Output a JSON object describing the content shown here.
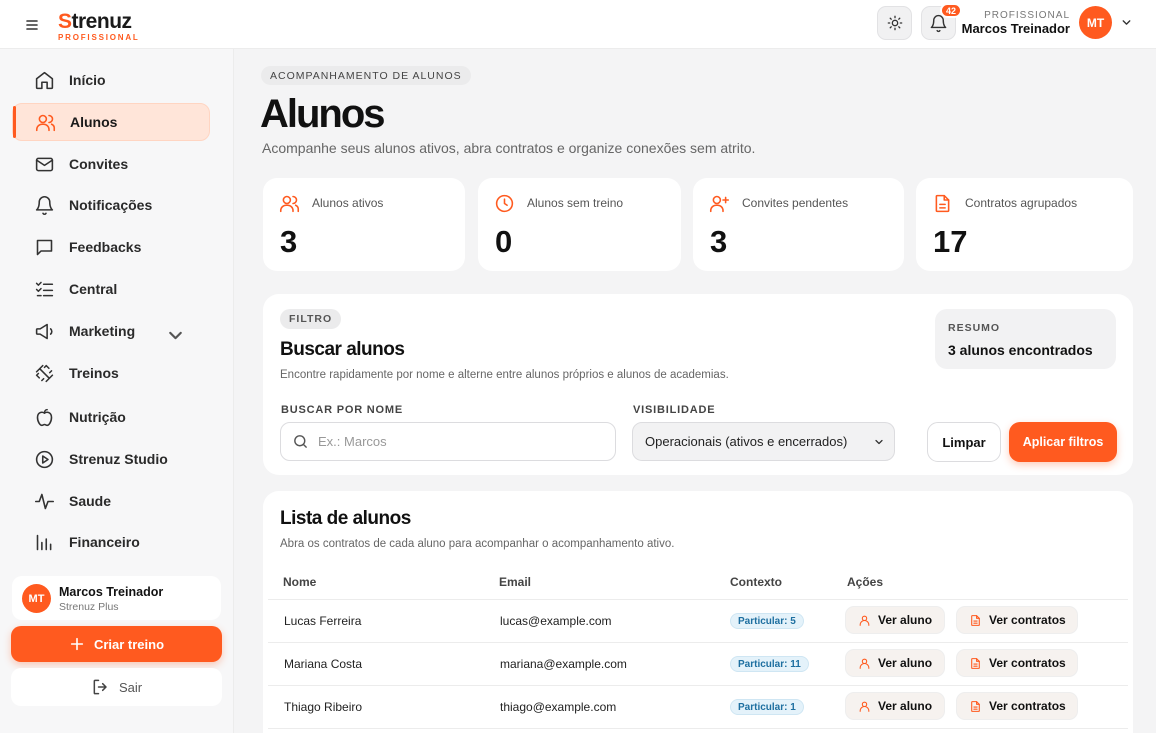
{
  "header": {
    "logo_main": "trenuz",
    "logo_s": "S",
    "logo_sub": "PROFISSIONAL",
    "notifications_count": "42",
    "user_role": "PROFISSIONAL",
    "user_name": "Marcos Treinador",
    "avatar_initials": "MT"
  },
  "sidebar": {
    "items": [
      {
        "label": "Início",
        "icon": "home-icon"
      },
      {
        "label": "Alunos",
        "icon": "users-icon",
        "active": true
      },
      {
        "label": "Convites",
        "icon": "mail-icon"
      },
      {
        "label": "Notificações",
        "icon": "bell-icon"
      },
      {
        "label": "Feedbacks",
        "icon": "chat-icon"
      },
      {
        "label": "Central",
        "icon": "list-check-icon"
      },
      {
        "label": "Marketing",
        "icon": "megaphone-icon",
        "expandable": true
      },
      {
        "label": "Treinos",
        "icon": "dumbbell-icon"
      },
      {
        "label": "Nutrição",
        "icon": "apple-icon"
      },
      {
        "label": "Strenuz Studio",
        "icon": "play-circle-icon"
      },
      {
        "label": "Saude",
        "icon": "activity-icon"
      },
      {
        "label": "Financeiro",
        "icon": "bar-chart-icon"
      }
    ],
    "profile": {
      "initials": "MT",
      "name": "Marcos Treinador",
      "plan": "Strenuz Plus"
    },
    "create_label": "Criar treino",
    "logout_label": "Sair"
  },
  "main": {
    "eyebrow": "ACOMPANHAMENTO DE ALUNOS",
    "title": "Alunos",
    "subtitle": "Acompanhe seus alunos ativos, abra contratos e organize conexões sem atrito.",
    "stats": [
      {
        "label": "Alunos ativos",
        "value": "3",
        "icon": "users-icon"
      },
      {
        "label": "Alunos sem treino",
        "value": "0",
        "icon": "clock-icon"
      },
      {
        "label": "Convites pendentes",
        "value": "3",
        "icon": "user-plus-icon"
      },
      {
        "label": "Contratos agrupados",
        "value": "17",
        "icon": "document-icon"
      }
    ],
    "filter": {
      "chip": "FILTRO",
      "title": "Buscar alunos",
      "subtitle": "Encontre rapidamente por nome e alterne entre alunos próprios e alunos de academias.",
      "summary_label": "RESUMO",
      "summary_value": "3 alunos encontrados",
      "search_label": "BUSCAR POR NOME",
      "search_placeholder": "Ex.: Marcos",
      "search_value": "",
      "visibility_label": "VISIBILIDADE",
      "visibility_value": "Operacionais (ativos e encerrados)",
      "clear_label": "Limpar",
      "apply_label": "Aplicar filtros"
    },
    "list": {
      "title": "Lista de alunos",
      "subtitle": "Abra os contratos de cada aluno para acompanhar o acompanhamento ativo.",
      "columns": [
        "Nome",
        "Email",
        "Contexto",
        "Ações"
      ],
      "view_student_label": "Ver aluno",
      "view_contracts_label": "Ver contratos",
      "rows": [
        {
          "name": "Lucas Ferreira",
          "email": "lucas@example.com",
          "context": "Particular: 5"
        },
        {
          "name": "Mariana Costa",
          "email": "mariana@example.com",
          "context": "Particular: 11"
        },
        {
          "name": "Thiago Ribeiro",
          "email": "thiago@example.com",
          "context": "Particular: 1"
        }
      ]
    }
  },
  "colors": {
    "accent": "#ff5a1f",
    "context_badge": "#1e6fa0"
  }
}
